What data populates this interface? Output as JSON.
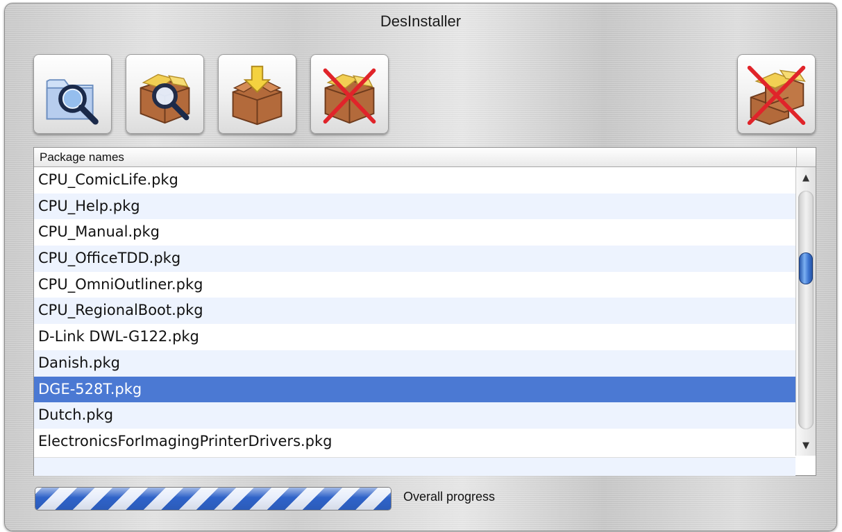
{
  "window": {
    "title": "DesInstaller"
  },
  "toolbar": {
    "buttons": [
      {
        "icon": "folder-magnifier-icon"
      },
      {
        "icon": "package-magnifier-icon"
      },
      {
        "icon": "package-install-icon"
      },
      {
        "icon": "package-delete-icon"
      },
      {
        "icon": "packages-delete-all-icon"
      }
    ]
  },
  "table": {
    "column_header": "Package names",
    "rows": [
      "CPU_ComicLife.pkg",
      "CPU_Help.pkg",
      "CPU_Manual.pkg",
      "CPU_OfficeTDD.pkg",
      "CPU_OmniOutliner.pkg",
      "CPU_RegionalBoot.pkg",
      "D-Link DWL-G122.pkg",
      "Danish.pkg",
      "DGE-528T.pkg",
      "Dutch.pkg",
      "ElectronicsForImagingPrinterDrivers.pkg"
    ],
    "selected_index": 8,
    "scroll_position": 0.3
  },
  "progress": {
    "label": "Overall progress",
    "value": 1.0
  },
  "colors": {
    "selection": "#4b79d3",
    "row_alt": "#edf3fe",
    "progress_stripe": "#2f63c9"
  }
}
